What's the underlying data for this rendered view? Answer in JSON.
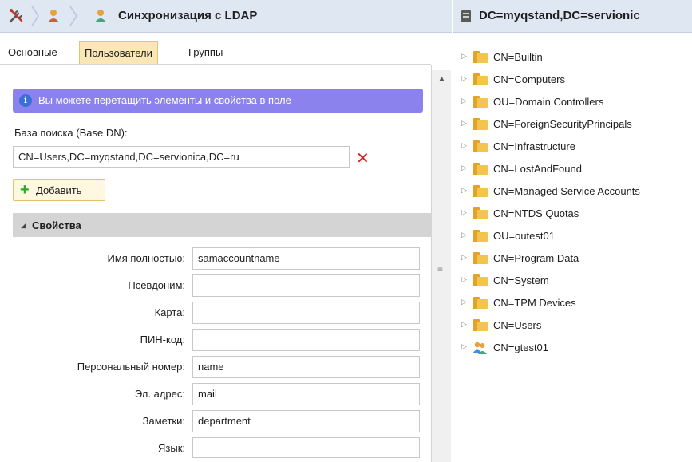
{
  "left_panel": {
    "title": "Синхронизация с LDAP",
    "tabs": [
      {
        "label": "Основные",
        "active": false
      },
      {
        "label": "Пользователи",
        "active": true
      },
      {
        "label": "Группы",
        "active": false
      }
    ],
    "info_text": "Вы можете перетащить элементы и свойства в поле",
    "base_dn_label": "База поиска (Base DN):",
    "base_dn_value": "CN=Users,DC=myqstand,DC=servionica,DC=ru",
    "add_button_label": "Добавить",
    "properties_section_title": "Свойства",
    "properties": [
      {
        "label": "Имя полностью:",
        "value": "samaccountname"
      },
      {
        "label": "Псевдоним:",
        "value": ""
      },
      {
        "label": "Карта:",
        "value": ""
      },
      {
        "label": "ПИН-код:",
        "value": ""
      },
      {
        "label": "Персональный номер:",
        "value": "name"
      },
      {
        "label": "Эл. адрес:",
        "value": "mail"
      },
      {
        "label": "Заметки:",
        "value": "department"
      },
      {
        "label": "Язык:",
        "value": ""
      }
    ]
  },
  "right_panel": {
    "title": "DC=myqstand,DC=servionic",
    "tree": [
      {
        "label": "CN=Builtin",
        "icon": "folder-icon"
      },
      {
        "label": "CN=Computers",
        "icon": "folder-icon"
      },
      {
        "label": "OU=Domain Controllers",
        "icon": "folder-icon"
      },
      {
        "label": "CN=ForeignSecurityPrincipals",
        "icon": "folder-icon"
      },
      {
        "label": "CN=Infrastructure",
        "icon": "folder-icon"
      },
      {
        "label": "CN=LostAndFound",
        "icon": "folder-icon"
      },
      {
        "label": "CN=Managed Service Accounts",
        "icon": "folder-icon"
      },
      {
        "label": "CN=NTDS Quotas",
        "icon": "folder-icon"
      },
      {
        "label": "OU=outest01",
        "icon": "folder-icon"
      },
      {
        "label": "CN=Program Data",
        "icon": "folder-icon"
      },
      {
        "label": "CN=System",
        "icon": "folder-icon"
      },
      {
        "label": "CN=TPM Devices",
        "icon": "folder-icon"
      },
      {
        "label": "CN=Users",
        "icon": "folder-icon"
      },
      {
        "label": "CN=gtest01",
        "icon": "group-icon"
      }
    ]
  },
  "colors": {
    "header_bg": "#dfe7f3",
    "info_bg": "#8c82ed",
    "active_tab_bg": "#fbe7b6",
    "delete_red": "#d02020",
    "add_green": "#2fa82f",
    "folder_yellow": "#f3c44e"
  }
}
